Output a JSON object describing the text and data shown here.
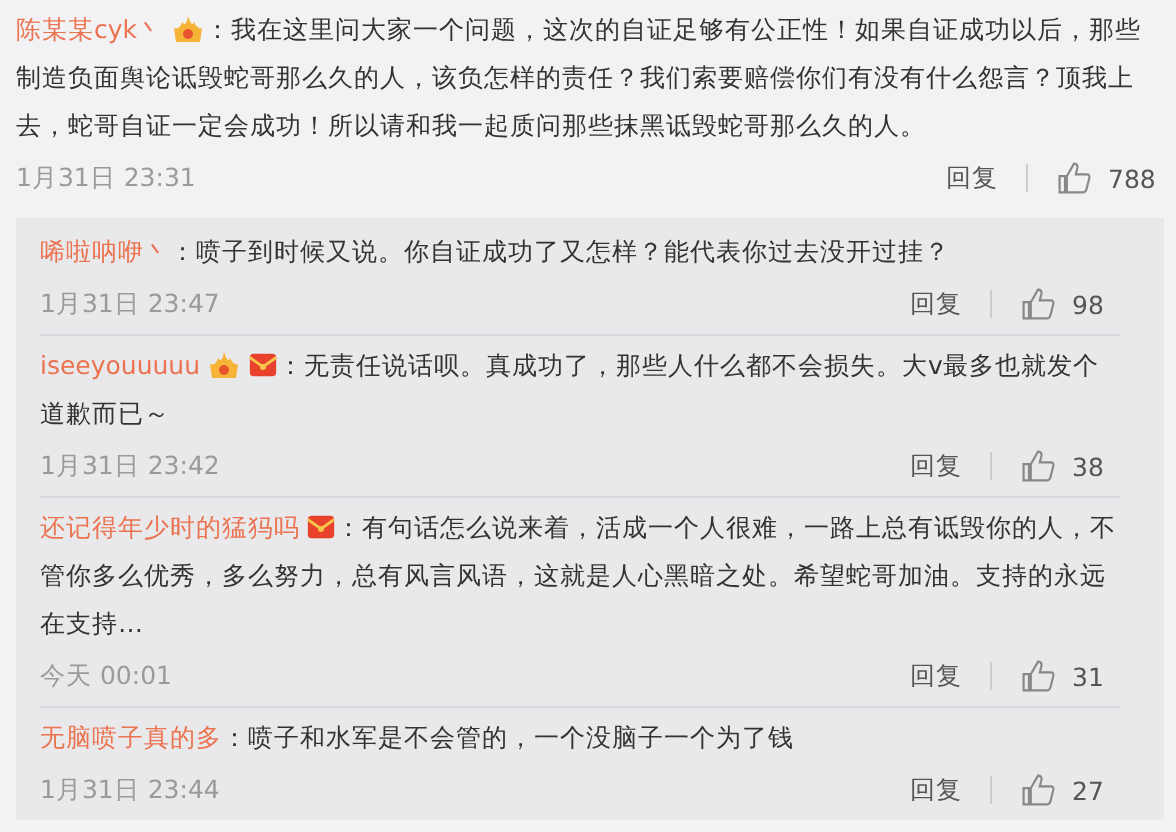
{
  "comment": {
    "name": "陈某某cyk丶",
    "fire_badge": true,
    "envelope_badge": false,
    "text": "：我在这里问大家一个问题，这次的自证足够有公正性！如果自证成功以后，那些制造负面舆论诋毁蛇哥那么久的人，该负怎样的责任？我们索要赔偿你们有没有什么怨言？顶我上去，蛇哥自证一定会成功！所以请和我一起质问那些抹黑诋毁蛇哥那么久的人。",
    "time": "1月31日 23:31",
    "reply": "回复",
    "likes": "788"
  },
  "replies": [
    {
      "name": "唏啦呐咿丶",
      "fire_badge": false,
      "envelope_badge": false,
      "text": "：喷子到时候又说。你自证成功了又怎样？能代表你过去没开过挂？",
      "time": "1月31日 23:47",
      "reply": "回复",
      "likes": "98"
    },
    {
      "name": "iseeyouuuuu",
      "fire_badge": true,
      "envelope_badge": true,
      "text": "：无责任说话呗。真成功了，那些人什么都不会损失。大v最多也就发个道歉而已～",
      "time": "1月31日 23:42",
      "reply": "回复",
      "likes": "38"
    },
    {
      "name": "还记得年少时的猛犸吗",
      "fire_badge": false,
      "envelope_badge": true,
      "text": "：有句话怎么说来着，活成一个人很难，一路上总有诋毁你的人，不管你多么优秀，多么努力，总有风言风语，这就是人心黑暗之处。希望蛇哥加油。支持的永远在支持…",
      "time": "今天 00:01",
      "reply": "回复",
      "likes": "31"
    },
    {
      "name": "无脑喷子真的多",
      "fire_badge": false,
      "envelope_badge": false,
      "text": "：喷子和水军是不会管的，一个没脑子一个为了钱",
      "time": "1月31日 23:44",
      "reply": "回复",
      "likes": "27"
    }
  ]
}
